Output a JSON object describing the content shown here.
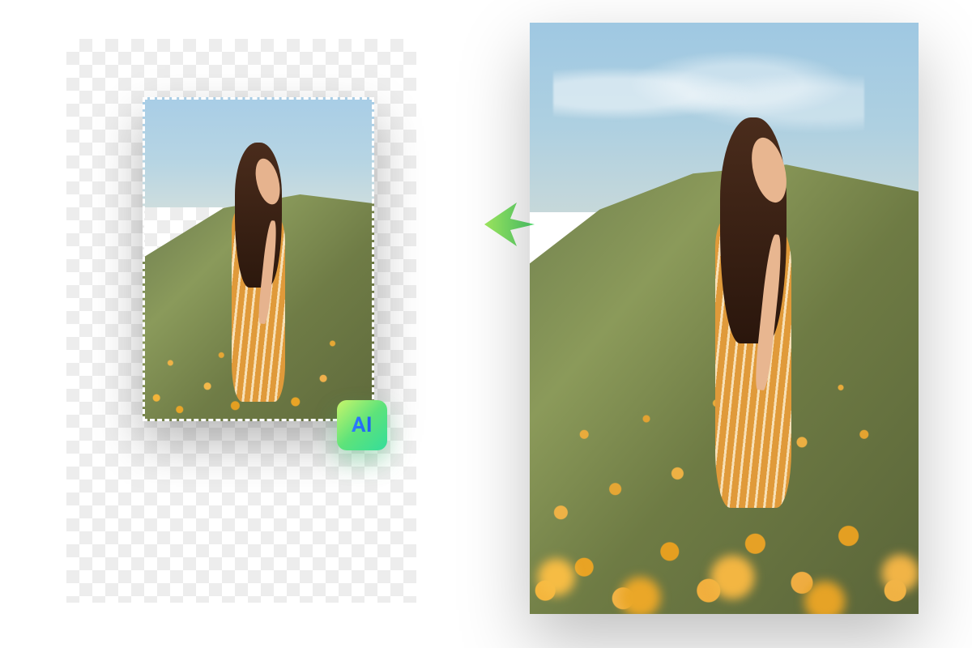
{
  "ai_badge": {
    "label": "AI"
  },
  "colors": {
    "badge_gradient_start": "#c8f56a",
    "badge_gradient_mid": "#5ee37a",
    "badge_gradient_end": "#34dd9b",
    "badge_text_gradient_start": "#2f7cff",
    "badge_text_gradient_end": "#1f5ef0",
    "arrow_gradient_start": "#9fe85f",
    "arrow_gradient_end": "#4fd36e"
  }
}
